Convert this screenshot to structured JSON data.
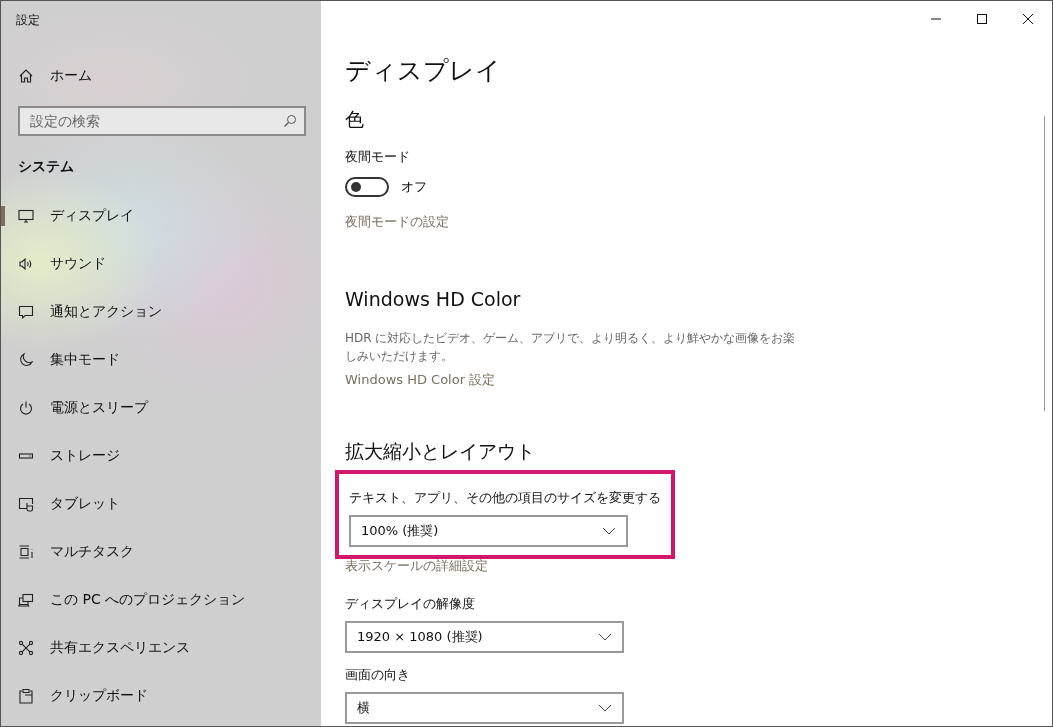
{
  "window": {
    "title": "設定"
  },
  "sidebar": {
    "home": "ホーム",
    "search": {
      "placeholder": "設定の検索"
    },
    "section": "システム",
    "items": [
      {
        "label": "ディスプレイ",
        "selected": true
      },
      {
        "label": "サウンド",
        "selected": false
      },
      {
        "label": "通知とアクション",
        "selected": false
      },
      {
        "label": "集中モード",
        "selected": false
      },
      {
        "label": "電源とスリープ",
        "selected": false
      },
      {
        "label": "ストレージ",
        "selected": false
      },
      {
        "label": "タブレット",
        "selected": false
      },
      {
        "label": "マルチタスク",
        "selected": false
      },
      {
        "label": "この PC へのプロジェクション",
        "selected": false
      },
      {
        "label": "共有エクスペリエンス",
        "selected": false
      },
      {
        "label": "クリップボード",
        "selected": false
      }
    ]
  },
  "page": {
    "title": "ディスプレイ",
    "color": {
      "heading": "色",
      "night_label": "夜間モード",
      "night_toggle": {
        "on": false,
        "state_text": "オフ"
      },
      "link": "夜間モードの設定"
    },
    "hd_color": {
      "heading": "Windows HD Color",
      "description": "HDR に対応したビデオ、ゲーム、アプリで、より明るく、より鮮やかな画像をお楽しみいただけます。",
      "link": "Windows HD Color 設定"
    },
    "scale": {
      "heading": "拡大縮小とレイアウト",
      "size": {
        "label": "テキスト、アプリ、その他の項目のサイズを変更する",
        "value": "100% (推奨)",
        "highlighted": true
      },
      "link": "表示スケールの詳細設定",
      "resolution": {
        "label": "ディスプレイの解像度",
        "value": "1920 × 1080 (推奨)"
      },
      "orientation": {
        "label": "画面の向き",
        "value": "横"
      }
    }
  }
}
